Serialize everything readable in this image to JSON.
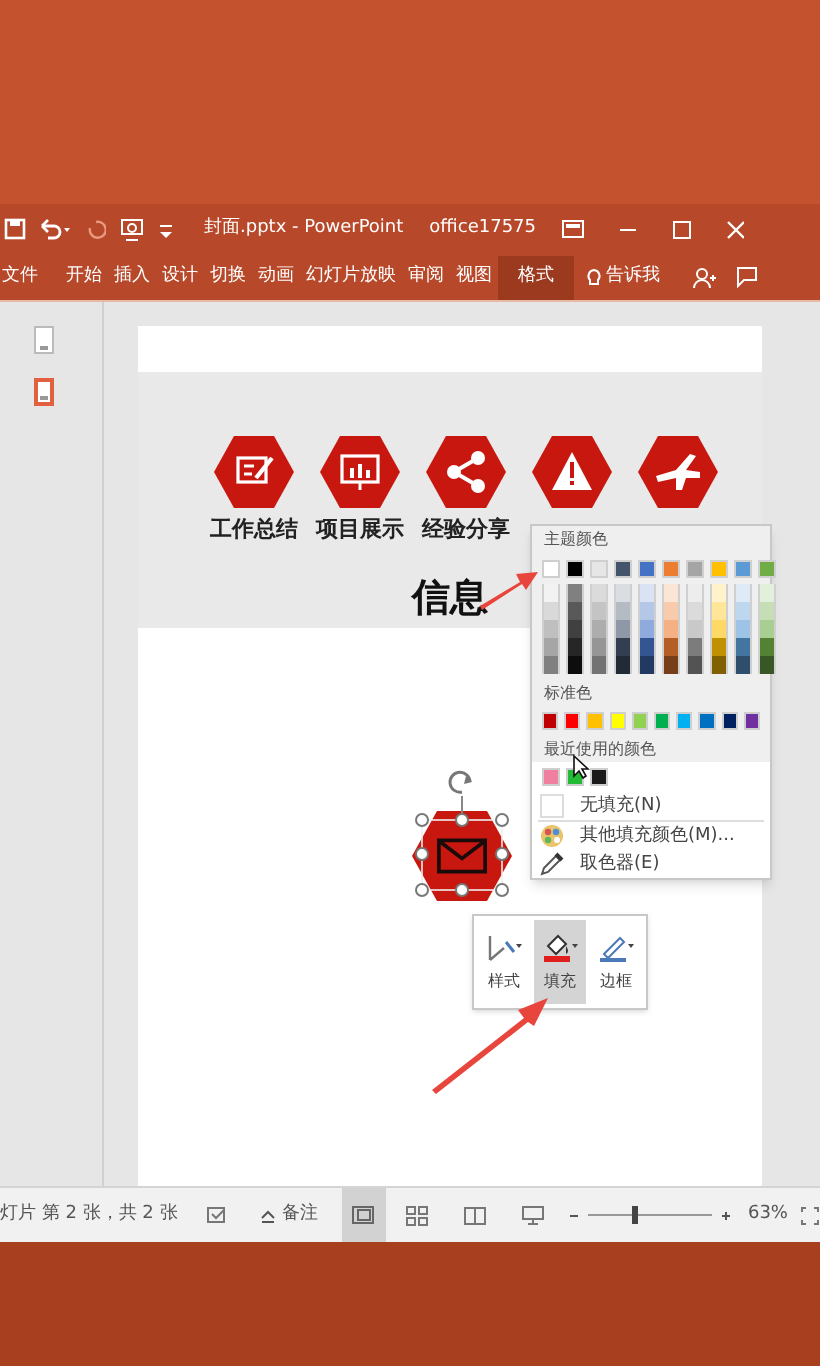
{
  "title_bar": {
    "title": "封面.pptx - PowerPoint",
    "user": "office17575"
  },
  "ribbon_tabs": [
    {
      "label": "文件",
      "selected": false
    },
    {
      "label": "开始",
      "selected": false
    },
    {
      "label": "插入",
      "selected": false
    },
    {
      "label": "设计",
      "selected": false
    },
    {
      "label": "切换",
      "selected": false
    },
    {
      "label": "动画",
      "selected": false
    },
    {
      "label": "幻灯片放映",
      "selected": false
    },
    {
      "label": "审阅",
      "selected": false
    },
    {
      "label": "视图",
      "selected": false
    },
    {
      "label": "格式",
      "selected": true
    }
  ],
  "tell_me": "告诉我",
  "thumbnails": [
    {
      "selected": false
    },
    {
      "selected": true
    }
  ],
  "slide": {
    "items": [
      {
        "kind": "note",
        "label": "工作总结"
      },
      {
        "kind": "chart",
        "label": "项目展示"
      },
      {
        "kind": "share",
        "label": "经验分享"
      },
      {
        "kind": "warning"
      },
      {
        "kind": "plane"
      }
    ],
    "title": "信息",
    "shape": {
      "kind": "envelope",
      "selected": true
    }
  },
  "color_menu": {
    "theme_heading": "主题颜色",
    "theme_colors": [
      {
        "color": "#ffffff"
      },
      {
        "color": "#000000"
      },
      {
        "color": "#e7e6e6"
      },
      {
        "color": "#44546a"
      },
      {
        "color": "#4472c4"
      },
      {
        "color": "#ed7d31"
      },
      {
        "color": "#a5a5a5"
      },
      {
        "color": "#ffc000"
      },
      {
        "color": "#5b9bd5"
      },
      {
        "color": "#70ad47"
      }
    ],
    "standard_heading": "标准色",
    "standard_colors": [
      {
        "color": "#c00000"
      },
      {
        "color": "#ff0000"
      },
      {
        "color": "#ffc000"
      },
      {
        "color": "#ffff00"
      },
      {
        "color": "#92d050"
      },
      {
        "color": "#00b050"
      },
      {
        "color": "#00b0f0"
      },
      {
        "color": "#0070c0"
      },
      {
        "color": "#002060"
      },
      {
        "color": "#7030a0"
      }
    ],
    "recent_heading": "最近使用的颜色",
    "recent_colors": [
      {
        "color": "#f07fa0"
      },
      {
        "color": "#22bb33"
      },
      {
        "color": "#1a1a1a"
      }
    ],
    "no_fill": "无填充(N)",
    "more_colors": "其他填充颜色(M)...",
    "eyedropper": "取色器(E)"
  },
  "mini_toolbar": [
    {
      "kind": "style",
      "label": "样式",
      "selected": false
    },
    {
      "kind": "fill",
      "label": "填充",
      "selected": true
    },
    {
      "kind": "outline",
      "label": "边框",
      "selected": false
    }
  ],
  "status_bar": {
    "slide_info": "灯片 第 2 张，共 2 张",
    "notes": "备注",
    "zoom": "63%",
    "level": 0.35
  }
}
